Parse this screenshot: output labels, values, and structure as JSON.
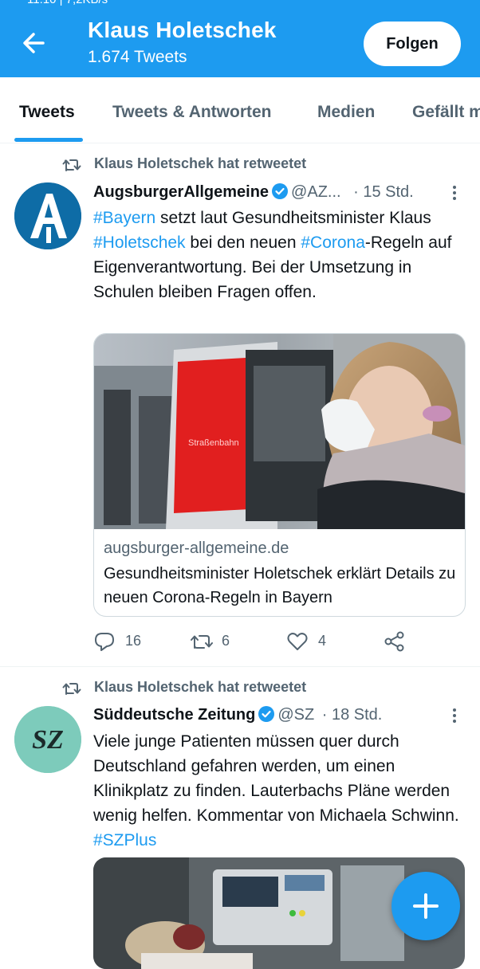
{
  "header": {
    "title": "Klaus Holetschek",
    "subtitle": "1.674 Tweets",
    "follow_label": "Folgen",
    "status_text": "11:10 | 7,2KB/s"
  },
  "tabs": [
    {
      "label": "Tweets",
      "active": true
    },
    {
      "label": "Tweets & Antworten",
      "active": false
    },
    {
      "label": "Medien",
      "active": false
    },
    {
      "label": "Gefällt m",
      "active": false
    }
  ],
  "tweets": [
    {
      "retweet_label": "Klaus Holetschek hat retweetet",
      "name": "AugsburgerAllgemeine",
      "handle": "@AZ...",
      "time": "· 15 Std.",
      "text_parts": [
        "#Bayern",
        " setzt laut Gesundheitsminister Klaus ",
        "#Holetschek",
        " bei den neuen ",
        "#Corona",
        "-Regeln auf Eigenverantwortung. Bei der Umsetzung in Schulen bleiben Fragen offen."
      ],
      "card": {
        "domain": "augsburger-allgemeine.de",
        "title": "Gesundheitsminister Holetschek erklärt Details zu neuen Corona-Regeln in Bayern",
        "train_text": "Straßenbahn"
      },
      "replies": "16",
      "retweets": "6",
      "likes": "4"
    },
    {
      "retweet_label": "Klaus Holetschek hat retweetet",
      "name": "Süddeutsche Zeitung",
      "handle": "@SZ",
      "time": "· 18 Std.",
      "avatar_text": "SZ",
      "text_main": "Viele junge Patienten müssen quer durch Deutschland gefahren werden, um einen Klinikplatz zu finden. Lauterbachs Pläne werden wenig helfen. Kommentar von Michaela Schwinn. ",
      "text_tag": "#SZPlus"
    }
  ],
  "colors": {
    "accent": "#1d9bf0",
    "text_primary": "#0f1419",
    "text_secondary": "#536471"
  }
}
